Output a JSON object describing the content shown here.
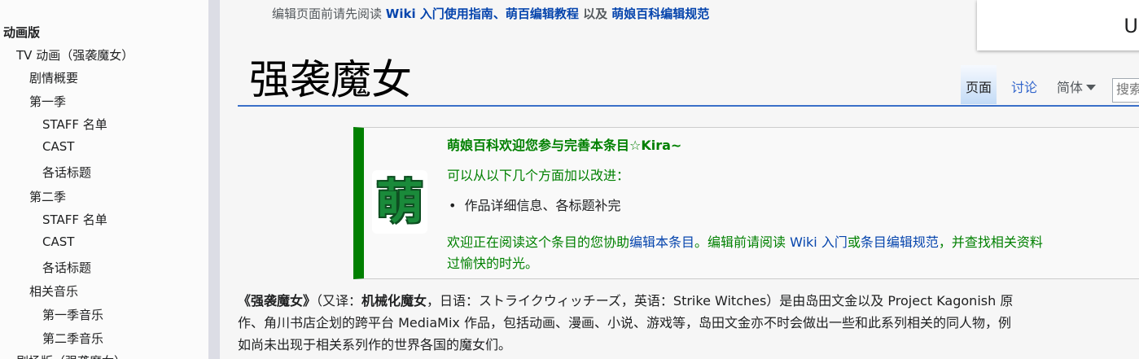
{
  "toc": {
    "items": [
      {
        "label": "动画版",
        "level": 0
      },
      {
        "label": "TV 动画（强袭魔女）",
        "level": 1
      },
      {
        "label": "剧情概要",
        "level": 2
      },
      {
        "label": "第一季",
        "level": 2
      },
      {
        "label": "STAFF 名单",
        "level": 3
      },
      {
        "label": "CAST",
        "level": 3
      },
      {
        "label": "各话标题",
        "level": 3
      },
      {
        "label": "第二季",
        "level": 2
      },
      {
        "label": "STAFF 名单",
        "level": 3
      },
      {
        "label": "CAST",
        "level": 3
      },
      {
        "label": "各话标题",
        "level": 3
      },
      {
        "label": "相关音乐",
        "level": 2
      },
      {
        "label": "第一季音乐",
        "level": 3
      },
      {
        "label": "第二季音乐",
        "level": 3
      },
      {
        "label": "剧场版（强袭魔女）",
        "level": 1
      }
    ]
  },
  "notice": {
    "prefix": "编辑页面前请先阅读 ",
    "link1": "Wiki 入门使用指南",
    "sep": "、",
    "link2": "萌百编辑教程",
    "mid": " 以及 ",
    "link3": "萌娘百科编辑规范"
  },
  "top_box": {
    "text": "U"
  },
  "page": {
    "title": "强袭魔女"
  },
  "tabs": {
    "page": "页面",
    "talk": "讨论",
    "variant": "简体",
    "search_placeholder": "搜索"
  },
  "welcome": {
    "logo_char": "萌",
    "title": "萌娘百科欢迎您参与完善本条目☆Kira~",
    "subtitle": "可以从以下几个方面加以改进：",
    "bullet": "作品详细信息、各标题补完",
    "body_line1_a": "欢迎正在阅读这个条目的您协助",
    "body_link1": "编辑本条目",
    "body_line1_b": "。编辑前请阅读 ",
    "body_link2": "Wiki 入门",
    "body_line1_c": "或",
    "body_link3": "条目编辑规范",
    "body_line1_d": "，并查找相关资料",
    "body_line2": "过愉快的时光。"
  },
  "intro": {
    "title_bold": "《强袭魔女》",
    "part1": "（又译：",
    "alt_bold": "机械化魔女",
    "part2": "，日语：ストライクウィッチーズ，英语：Strike Witches）是由岛田文金以及 Project Kagonish 原",
    "line2": "作、角川书店企划的跨平台 MediaMix 作品，包括动画、漫画、小说、游戏等，岛田文金亦不时会做出一些和此系列相关的同人物，例",
    "line3": "如尚未出现于相关系列作的世界各国的魔女们。"
  },
  "colors": {
    "accent_green": "#008000",
    "link_blue": "#0645ad",
    "title_underline": "#3a6fc8"
  }
}
